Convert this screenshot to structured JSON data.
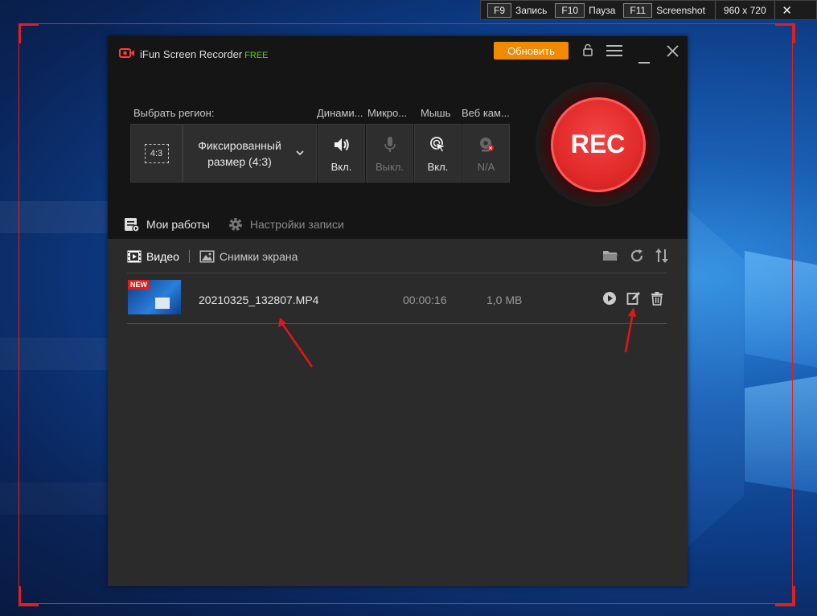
{
  "hotbar": {
    "keys": [
      {
        "key": "F9",
        "label": "Запись"
      },
      {
        "key": "F10",
        "label": "Пауза"
      },
      {
        "key": "F11",
        "label": "Screenshot"
      }
    ],
    "size": "960 x 720",
    "close": "✕"
  },
  "app": {
    "title": "iFun Screen Recorder",
    "edition": "FREE",
    "update_button": "Обновить"
  },
  "controls": {
    "region_label": "Выбрать регион:",
    "region_ratio": "4:3",
    "region_value_line1": "Фиксированный",
    "region_value_line2": "размер (4:3)",
    "speaker": {
      "header": "Динами...",
      "state": "Вкл."
    },
    "mic": {
      "header": "Микро...",
      "state": "Выкл."
    },
    "mouse": {
      "header": "Мышь",
      "state": "Вкл."
    },
    "webcam": {
      "header": "Веб кам...",
      "state": "N/A"
    },
    "rec_label": "REC"
  },
  "nav": {
    "my_works": "Мои работы",
    "record_settings": "Настройки записи"
  },
  "tabs": {
    "video": "Видео",
    "screenshots": "Снимки экрана"
  },
  "files": [
    {
      "badge": "NEW",
      "name": "20210325_132807.MP4",
      "duration": "00:00:16",
      "size": "1,0 MB"
    }
  ],
  "colors": {
    "accent_orange": "#f28a00",
    "rec_red": "#e22a2a",
    "free_green": "#5fd021",
    "frame_red": "#e02020"
  }
}
